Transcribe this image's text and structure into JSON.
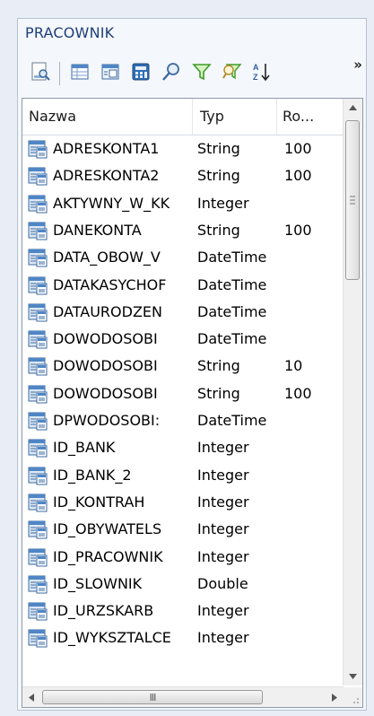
{
  "panel": {
    "title": "PRACOWNIK"
  },
  "toolbar": {
    "buttons": [
      {
        "icon": "preview-icon"
      },
      {
        "icon": "table-icon"
      },
      {
        "icon": "form-icon"
      },
      {
        "icon": "calculator-icon"
      },
      {
        "icon": "search-icon"
      },
      {
        "icon": "filter-icon"
      },
      {
        "icon": "clear-filter-icon"
      },
      {
        "icon": "sort-az-icon"
      }
    ],
    "overflow_label": "»"
  },
  "grid": {
    "columns": [
      "Nazwa",
      "Typ",
      "Ro..."
    ],
    "rows": [
      {
        "name": "ADRESKONTA1",
        "type": "String",
        "len": "100"
      },
      {
        "name": "ADRESKONTA2",
        "type": "String",
        "len": "100"
      },
      {
        "name": "AKTYWNY_W_KK",
        "type": "Integer",
        "len": ""
      },
      {
        "name": "DANEKONTA",
        "type": "String",
        "len": "100"
      },
      {
        "name": "DATA_OBOW_V",
        "type": "DateTime",
        "len": ""
      },
      {
        "name": "DATAKASYCHOF",
        "type": "DateTime",
        "len": ""
      },
      {
        "name": "DATAURODZEN",
        "type": "DateTime",
        "len": ""
      },
      {
        "name": "DOWODOSOBI",
        "type": "DateTime",
        "len": ""
      },
      {
        "name": "DOWODOSOBI",
        "type": "String",
        "len": "10"
      },
      {
        "name": "DOWODOSOBI",
        "type": "String",
        "len": "100"
      },
      {
        "name": "DPWODOSOBI:",
        "type": "DateTime",
        "len": ""
      },
      {
        "name": "ID_BANK",
        "type": "Integer",
        "len": ""
      },
      {
        "name": "ID_BANK_2",
        "type": "Integer",
        "len": ""
      },
      {
        "name": "ID_KONTRAH",
        "type": "Integer",
        "len": ""
      },
      {
        "name": "ID_OBYWATELS",
        "type": "Integer",
        "len": ""
      },
      {
        "name": "ID_PRACOWNIK",
        "type": "Integer",
        "len": ""
      },
      {
        "name": "ID_SLOWNIK",
        "type": "Double",
        "len": ""
      },
      {
        "name": "ID_URZSKARB",
        "type": "Integer",
        "len": ""
      },
      {
        "name": "ID_WYKSZTALCE",
        "type": "Integer",
        "len": ""
      }
    ],
    "hscroll_grip": "III"
  },
  "colors": {
    "title": "#1e3e7a",
    "accent": "#2a6fb8"
  }
}
